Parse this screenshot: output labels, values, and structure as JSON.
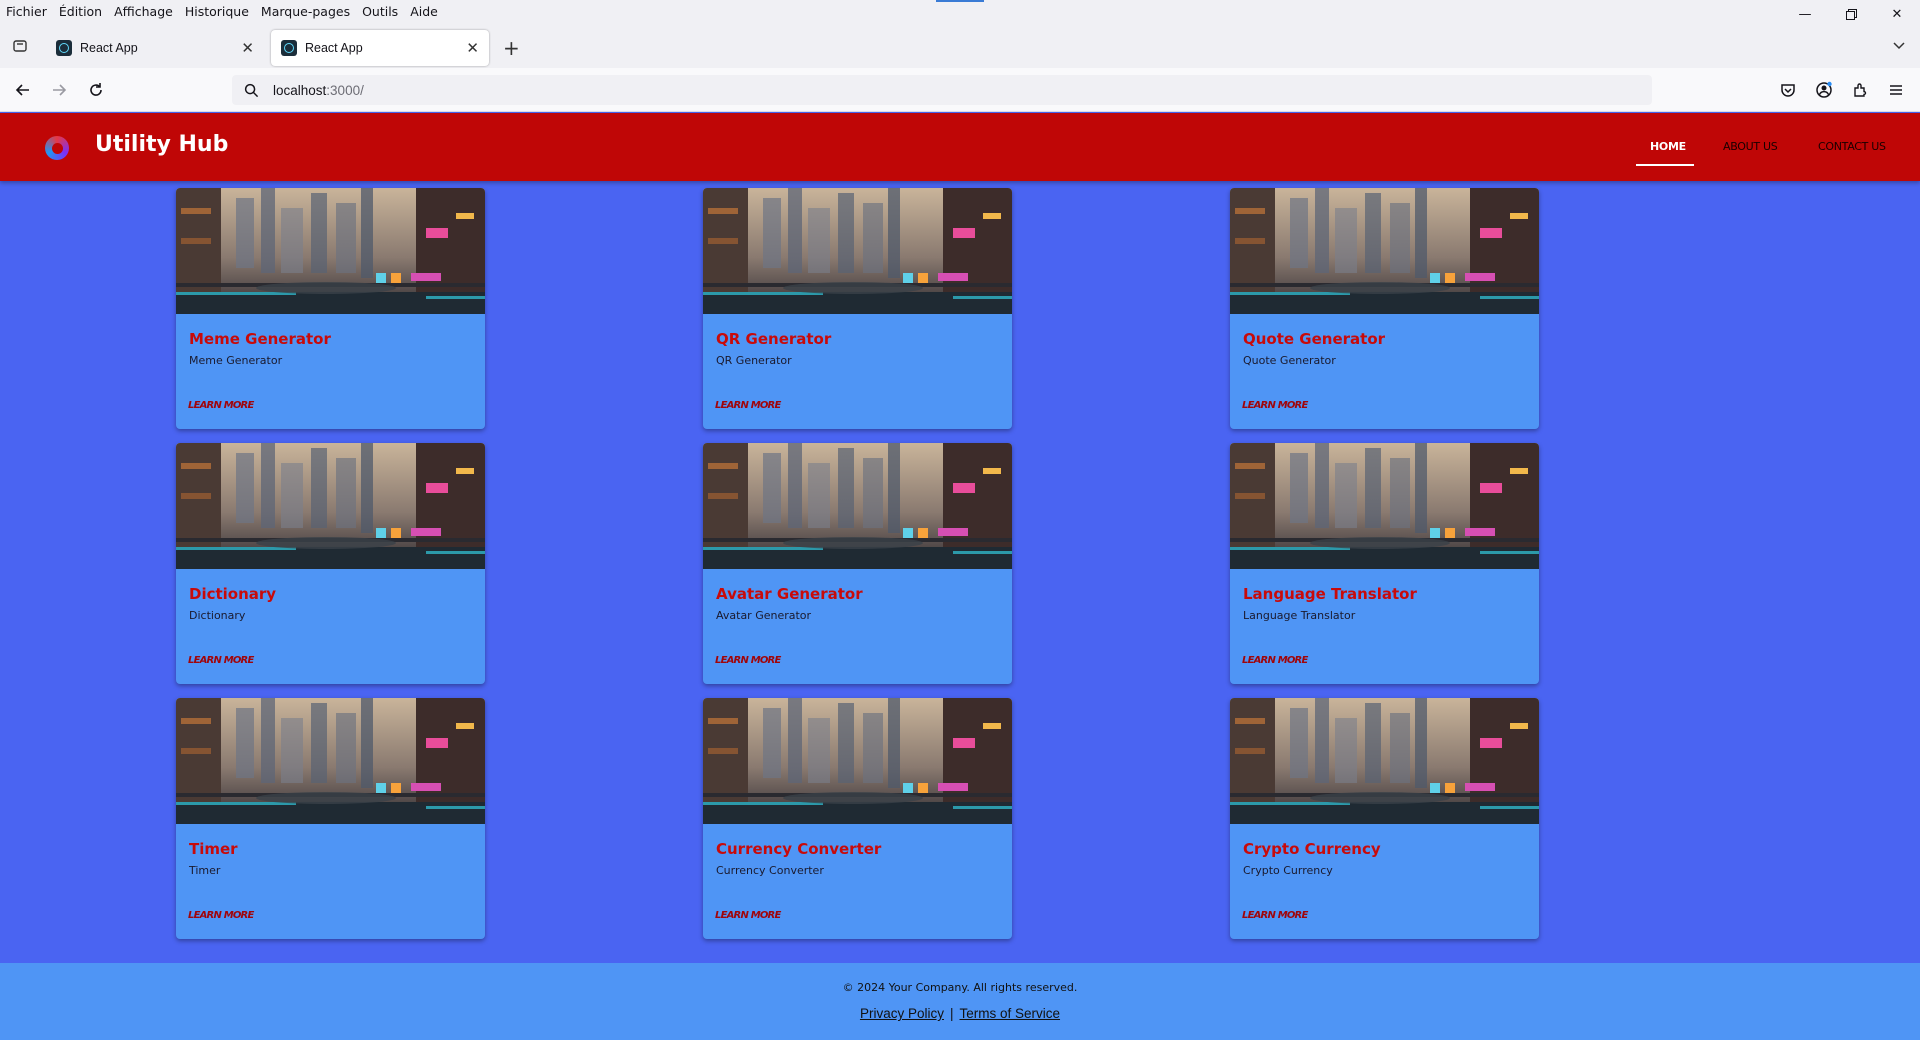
{
  "browser": {
    "menu": [
      "Fichier",
      "Édition",
      "Affichage",
      "Historique",
      "Marque-pages",
      "Outils",
      "Aide"
    ],
    "tabs": [
      {
        "title": "React App",
        "active": false
      },
      {
        "title": "React App",
        "active": true
      }
    ],
    "url_host": "localhost",
    "url_port": ":3000/"
  },
  "header": {
    "brand": "Utility Hub",
    "nav": [
      "HOME",
      "ABOUT US",
      "CONTACT US"
    ],
    "active_nav": "HOME"
  },
  "cards": [
    {
      "title": "Meme Generator",
      "description": "Meme Generator",
      "link": "LEARN MORE"
    },
    {
      "title": "QR Generator",
      "description": "QR Generator",
      "link": "LEARN MORE"
    },
    {
      "title": "Quote Generator",
      "description": "Quote Generator",
      "link": "LEARN MORE"
    },
    {
      "title": "Dictionary",
      "description": "Dictionary",
      "link": "LEARN MORE"
    },
    {
      "title": "Avatar Generator",
      "description": "Avatar Generator",
      "link": "LEARN MORE"
    },
    {
      "title": "Language Translator",
      "description": "Language Translator",
      "link": "LEARN MORE"
    },
    {
      "title": "Timer",
      "description": "Timer",
      "link": "LEARN MORE"
    },
    {
      "title": "Currency Converter",
      "description": "Currency Converter",
      "link": "LEARN MORE"
    },
    {
      "title": "Crypto Currency",
      "description": "Crypto Currency",
      "link": "LEARN MORE"
    }
  ],
  "footer": {
    "copyright": "© 2024 Your Company. All rights reserved.",
    "privacy": "Privacy Policy",
    "separator": "|",
    "terms": "Terms of Service"
  },
  "colors": {
    "page_bg": "#4a64f2",
    "header_bg": "#bf0606",
    "card_bg": "#4f95f5",
    "card_title": "#c80a0a"
  }
}
